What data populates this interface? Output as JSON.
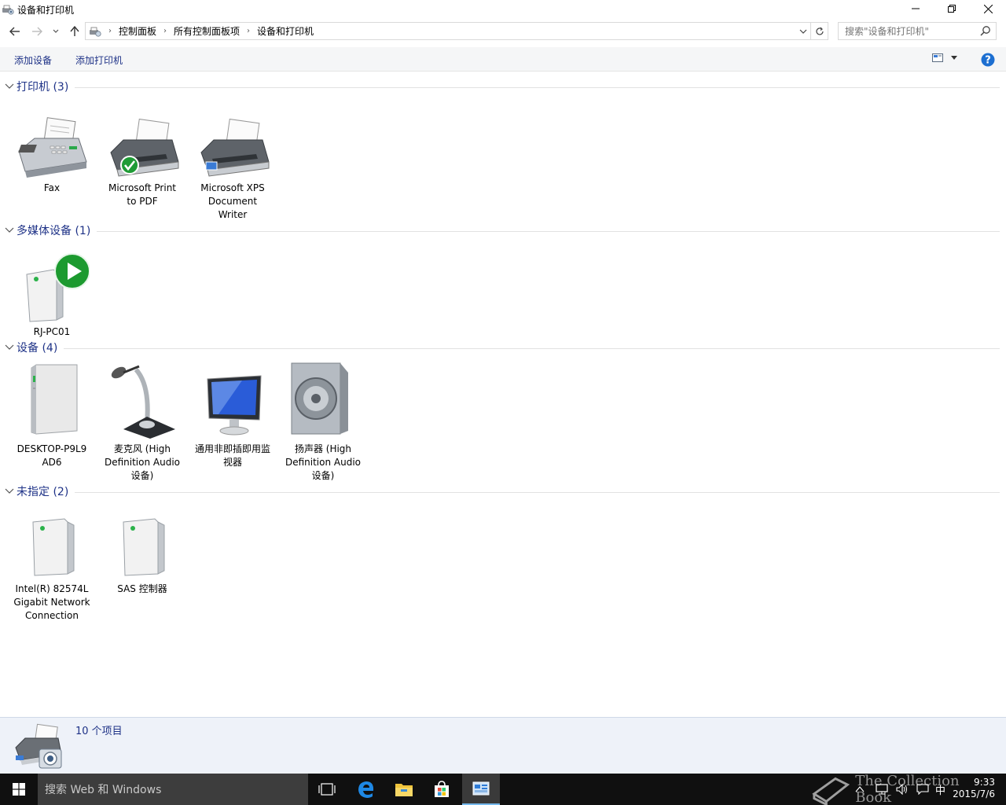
{
  "window": {
    "title": "设备和打印机"
  },
  "address": {
    "crumbs": [
      "控制面板",
      "所有控制面板项",
      "设备和打印机"
    ],
    "search_placeholder": "搜索\"设备和打印机\""
  },
  "commands": {
    "add_device": "添加设备",
    "add_printer": "添加打印机"
  },
  "groups": [
    {
      "title": "打印机 (3)",
      "items": [
        {
          "label": "Fax",
          "icon": "fax-icon"
        },
        {
          "label": "Microsoft Print to PDF",
          "icon": "printer-default-icon"
        },
        {
          "label": "Microsoft XPS Document Writer",
          "icon": "printer-icon"
        }
      ]
    },
    {
      "title": "多媒体设备 (1)",
      "items": [
        {
          "label": "RJ-PC01",
          "icon": "media-server-icon"
        }
      ]
    },
    {
      "title": "设备 (4)",
      "items": [
        {
          "label": "DESKTOP-P9L9 AD6",
          "icon": "computer-tower-icon"
        },
        {
          "label": "麦克风 (High Definition Audio 设备)",
          "icon": "microphone-icon"
        },
        {
          "label": "通用非即插即用监视器",
          "icon": "monitor-icon"
        },
        {
          "label": "扬声器 (High Definition Audio 设备)",
          "icon": "speaker-icon"
        }
      ]
    },
    {
      "title": "未指定 (2)",
      "items": [
        {
          "label": "Intel(R) 82574L Gigabit Network Connection",
          "icon": "generic-device-icon"
        },
        {
          "label": "SAS 控制器",
          "icon": "generic-device-icon"
        }
      ]
    }
  ],
  "details": {
    "count": "10 个项目"
  },
  "taskbar": {
    "search_placeholder": "搜索 Web 和 Windows",
    "time": "9:33",
    "date": "2015/7/6",
    "ime": "中",
    "watermark": "The Collection Book"
  }
}
